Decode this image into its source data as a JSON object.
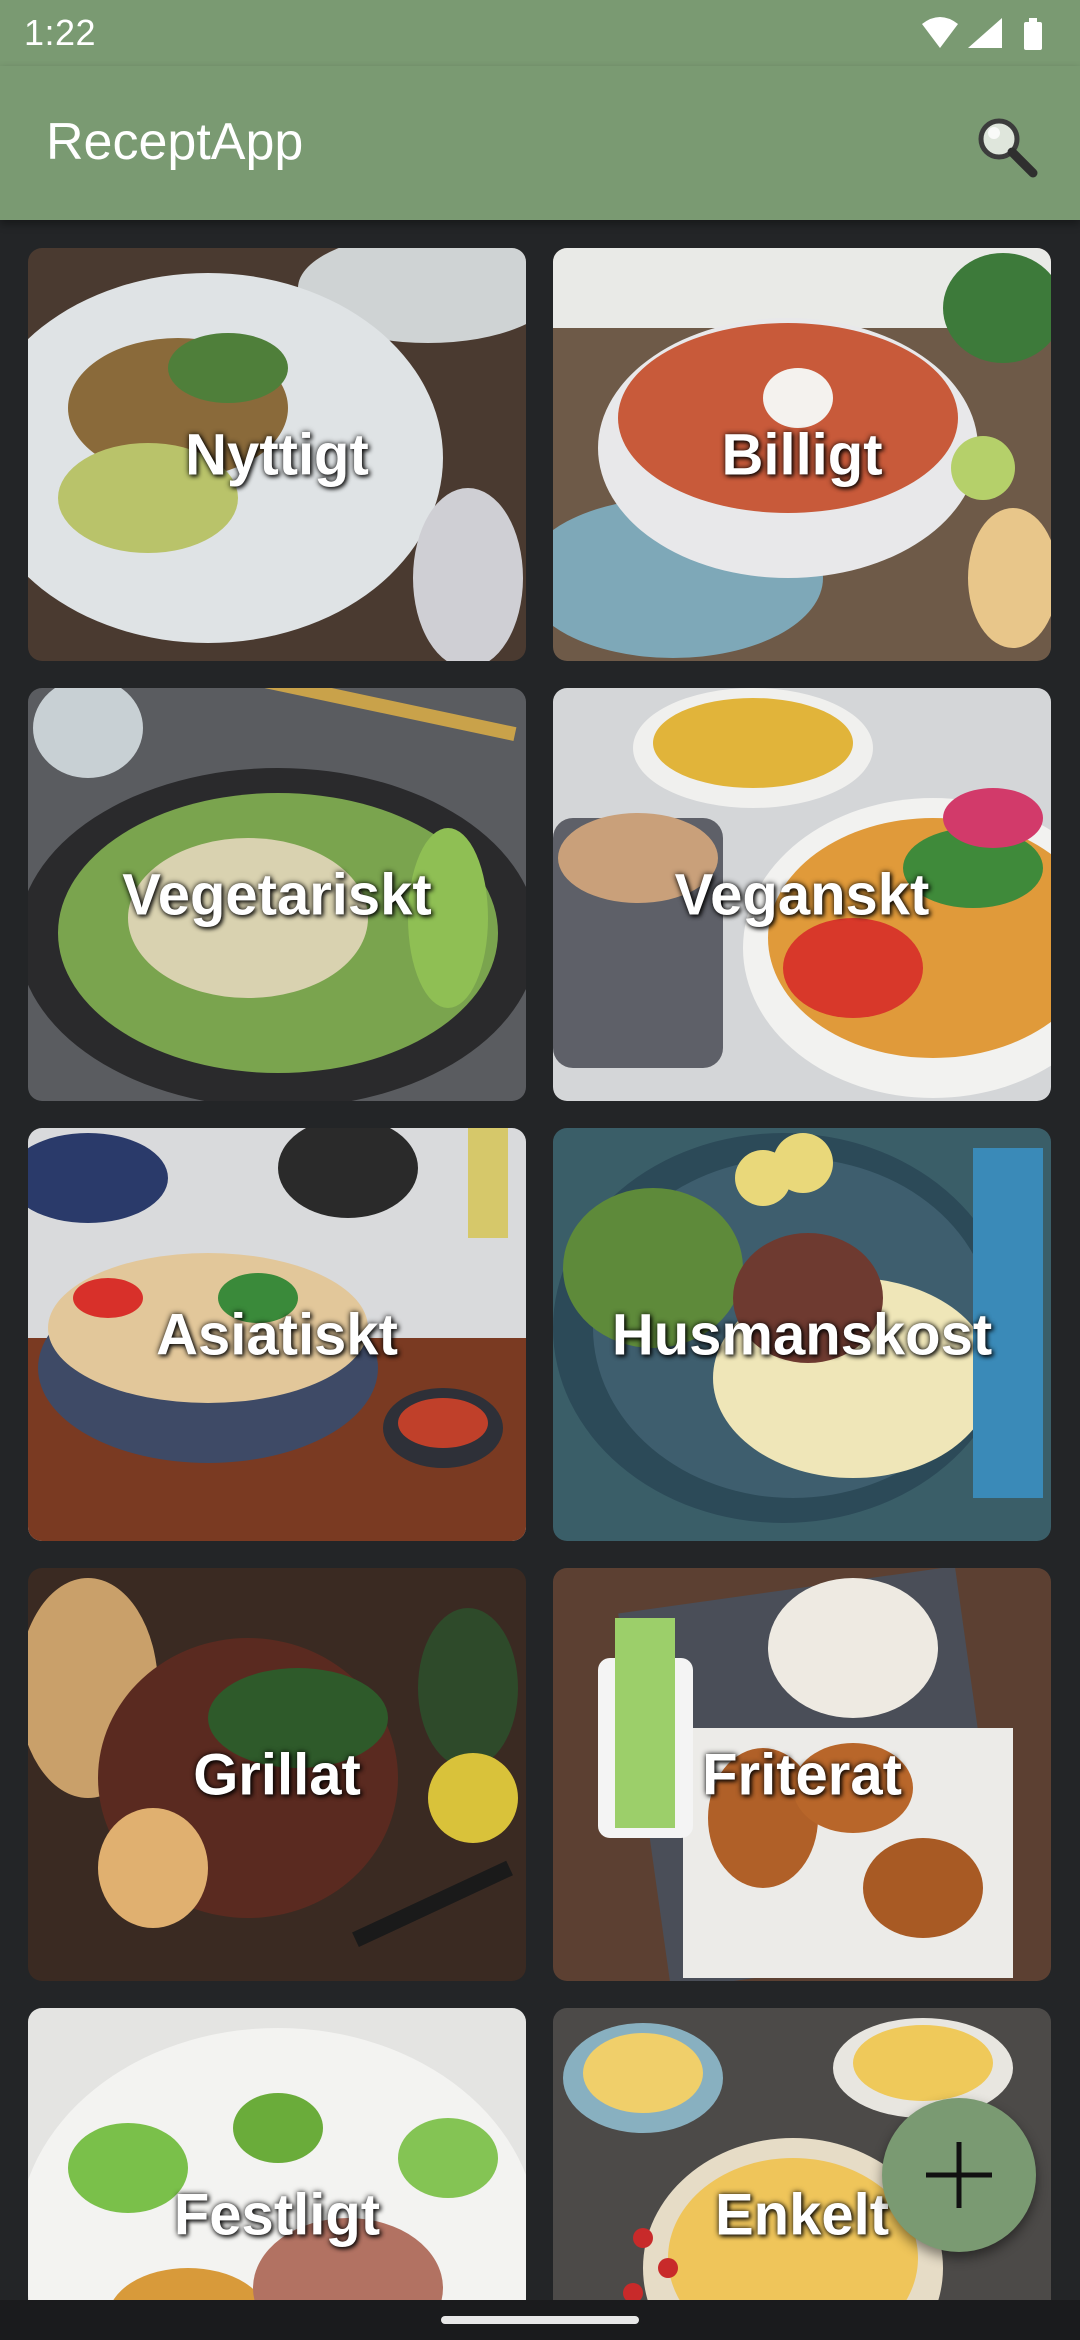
{
  "status_bar": {
    "time": "1:22",
    "icons": [
      "wifi-icon",
      "signal-icon",
      "battery-icon"
    ]
  },
  "app_bar": {
    "title": "ReceptApp",
    "search_icon": "search-icon"
  },
  "colors": {
    "primary": "#7a9a72",
    "background": "#232527",
    "text_on_primary": "#ffffff"
  },
  "categories": [
    {
      "label": "Nyttigt"
    },
    {
      "label": "Billigt"
    },
    {
      "label": "Vegetariskt"
    },
    {
      "label": "Veganskt"
    },
    {
      "label": "Asiatiskt"
    },
    {
      "label": "Husmanskost"
    },
    {
      "label": "Grillat"
    },
    {
      "label": "Friterat"
    },
    {
      "label": "Festligt"
    },
    {
      "label": "Enkelt"
    }
  ],
  "fab": {
    "icon": "plus-icon"
  }
}
